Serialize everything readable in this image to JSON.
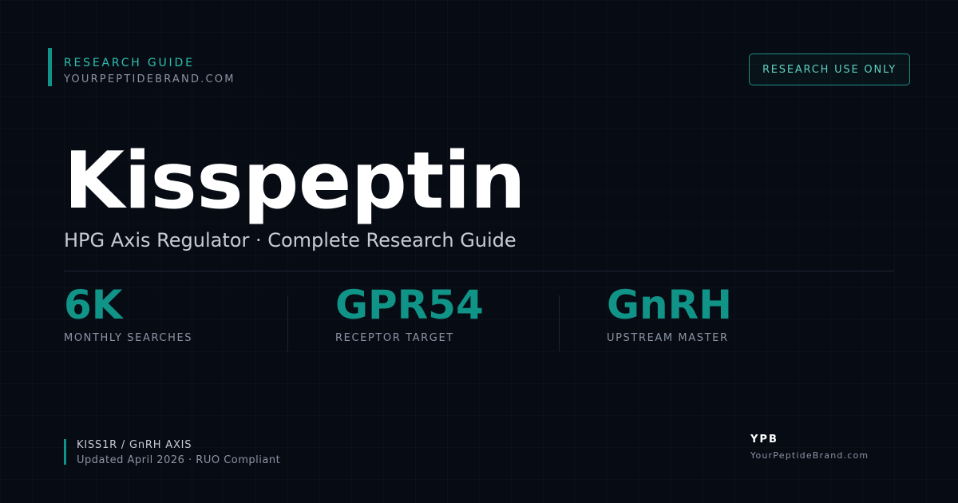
{
  "header": {
    "eyebrow": "RESEARCH GUIDE",
    "domain": "YOURPEPTIDEBRAND.COM",
    "badge": "RESEARCH USE ONLY"
  },
  "hero": {
    "title": "Kisspeptin",
    "subtitle": "HPG Axis Regulator · Complete Research Guide"
  },
  "stats": [
    {
      "value": "6K",
      "label": "MONTHLY SEARCHES"
    },
    {
      "value": "GPR54",
      "label": "RECEPTOR TARGET"
    },
    {
      "value": "GnRH",
      "label": "UPSTREAM MASTER"
    }
  ],
  "footer": {
    "tag": "KISS1R / GnRH AXIS",
    "updated": "Updated April 2026 · RUO Compliant",
    "logo": "YPB",
    "site": "YourPeptideBrand.com"
  },
  "colors": {
    "background": "#070b14",
    "accent": "#119488",
    "accent_light": "#2bc1ad",
    "text_muted": "#8a94a3"
  }
}
